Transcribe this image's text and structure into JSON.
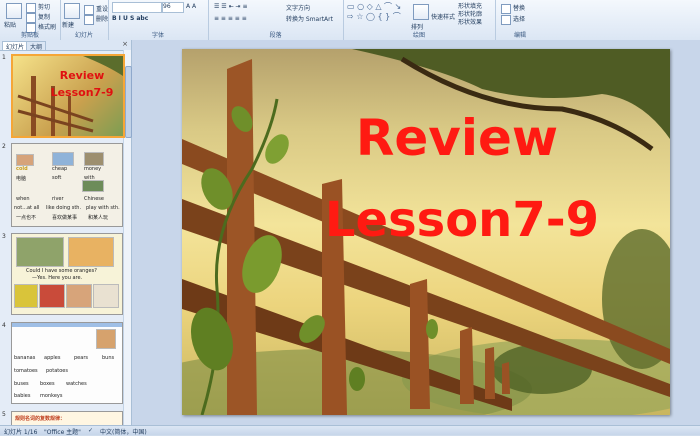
{
  "ribbon": {
    "clipboard": {
      "paste": "粘贴",
      "cut": "剪切",
      "copy": "复制",
      "format_painter": "格式刷",
      "label": "剪贴板"
    },
    "slides": {
      "new_slide": "新建\n幻灯片",
      "delete": "删除",
      "reset": "重设",
      "label": "幻灯片"
    },
    "font": {
      "size": "96",
      "label": "字体"
    },
    "paragraph": {
      "text_direction": "文字方向",
      "convert_smartart": "转换为 SmartArt",
      "label": "段落"
    },
    "drawing": {
      "arrange": "排列",
      "quick_styles": "快速样式",
      "fill": "形状填充",
      "outline": "形状轮廓",
      "effects": "形状效果",
      "label": "绘图"
    },
    "editing": {
      "replace": "替换",
      "select": "选择",
      "label": "编辑"
    }
  },
  "left_panel": {
    "tabs": [
      "幻灯片",
      "大纲"
    ],
    "slides": [
      {
        "num": "1",
        "title1": "Review",
        "title2": "Lesson7-9"
      },
      {
        "num": "2",
        "words": [
          "cold",
          "cheap",
          "money",
          "电脑",
          "soft",
          "with",
          "when",
          "river",
          "Chinese",
          "not...at all",
          "like doing sth.",
          "play with sth.",
          "一点也不",
          "喜欢做某事",
          "和某人玩"
        ]
      },
      {
        "num": "3",
        "words": [
          "Could I have some oranges?",
          "—Yes.  Here you are."
        ]
      },
      {
        "num": "4",
        "words": [
          "bananas",
          "apples",
          "pears",
          "buns",
          "tomatoes",
          "potatoes",
          "buses",
          "boxes",
          "watches",
          "babies",
          "monkeys"
        ]
      },
      {
        "num": "5",
        "words": [
          "规则名词的复数规律："
        ]
      }
    ]
  },
  "slide": {
    "title_line1": "Review",
    "title_line2": "Lesson7-9"
  },
  "status": {
    "slide_count": "幻灯片 1/16",
    "theme": "\"Office 主题\"",
    "language": "中文(简体，中国)"
  },
  "colors": {
    "title_red": "#ff1a12",
    "selected_border": "#f5a637"
  }
}
